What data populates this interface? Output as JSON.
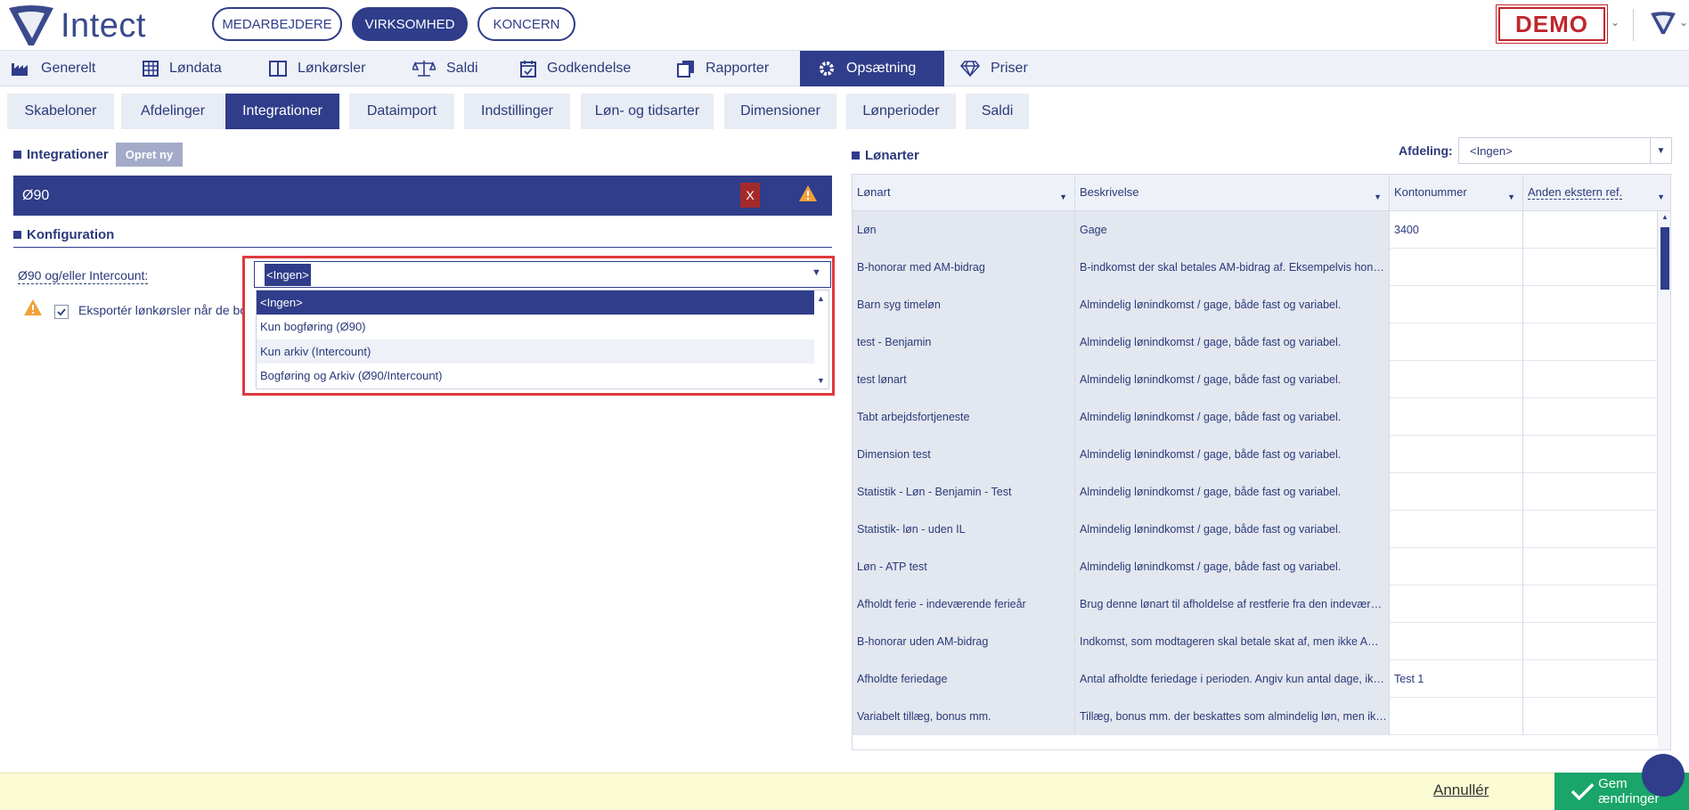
{
  "header": {
    "logo_text": "Intect",
    "pills": [
      "MEDARBEJDERE",
      "VIRKSOMHED",
      "KONCERN"
    ],
    "demo_label": "DEMO"
  },
  "main_nav": [
    {
      "label": "Generelt",
      "icon": "factory-icon"
    },
    {
      "label": "Løndata",
      "icon": "grid-icon"
    },
    {
      "label": "Lønkørsler",
      "icon": "book-icon"
    },
    {
      "label": "Saldi",
      "icon": "scale-icon"
    },
    {
      "label": "Godkendelse",
      "icon": "calendar-check-icon"
    },
    {
      "label": "Rapporter",
      "icon": "copy-icon"
    },
    {
      "label": "Opsætning",
      "icon": "gear-icon",
      "active": true
    },
    {
      "label": "Priser",
      "icon": "diamond-icon"
    }
  ],
  "sub_tabs": [
    "Skabeloner",
    "Afdelinger",
    "Integrationer",
    "Dataimport",
    "Indstillinger",
    "Løn- og tidsarter",
    "Dimensioner",
    "Lønperioder",
    "Saldi"
  ],
  "integrations": {
    "title": "Integrationer",
    "new_button": "Opret ny",
    "selected": "Ø90",
    "delete_label": "X"
  },
  "config": {
    "title": "Konfiguration",
    "field_label": "Ø90 og/eller Intercount:",
    "field_value": "<Ingen>",
    "checkbox_label": "Eksportér lønkørsler når de bogfø",
    "options": [
      "<Ingen>",
      "Kun bogføring (Ø90)",
      "Kun arkiv (Intercount)",
      "Bogføring og Arkiv (Ø90/Intercount)"
    ]
  },
  "lonarter": {
    "title": "Lønarter",
    "afdeling_label": "Afdeling:",
    "afdeling_value": "<Ingen>",
    "columns": [
      "Lønart",
      "Beskrivelse",
      "Kontonummer",
      "Anden ekstern ref."
    ],
    "rows": [
      [
        "Løn",
        "Gage",
        "3400",
        ""
      ],
      [
        "B-honorar med AM-bidrag",
        "B-indkomst der skal betales AM-bidrag af. Eksempelvis hon…",
        "",
        ""
      ],
      [
        "Barn syg timeløn",
        "Almindelig lønindkomst / gage, både fast og variabel.",
        "",
        ""
      ],
      [
        "test - Benjamin",
        "Almindelig lønindkomst / gage, både fast og variabel.",
        "",
        ""
      ],
      [
        "test lønart",
        "Almindelig lønindkomst / gage, både fast og variabel.",
        "",
        ""
      ],
      [
        "Tabt arbejdsfortjeneste",
        "Almindelig lønindkomst / gage, både fast og variabel.",
        "",
        ""
      ],
      [
        "Dimension test",
        "Almindelig lønindkomst / gage, både fast og variabel.",
        "",
        ""
      ],
      [
        "Statistik - Løn - Benjamin - Test",
        "Almindelig lønindkomst / gage, både fast og variabel.",
        "",
        ""
      ],
      [
        "Statistik- løn - uden IL",
        "Almindelig lønindkomst / gage, både fast og variabel.",
        "",
        ""
      ],
      [
        "Løn - ATP test",
        "Almindelig lønindkomst / gage, både fast og variabel.",
        "",
        ""
      ],
      [
        "Afholdt ferie - indeværende ferieår",
        "Brug denne lønart til afholdelse af restferie fra den indevær…",
        "",
        ""
      ],
      [
        "B-honorar uden AM-bidrag",
        "Indkomst, som modtageren skal betale skat af, men ikke A…",
        "",
        ""
      ],
      [
        "Afholdte feriedage",
        "Antal afholdte feriedage i perioden. Angiv kun antal dage, ik…",
        "Test 1",
        ""
      ],
      [
        "Variabelt tillæg, bonus mm.",
        "Tillæg, bonus mm. der beskattes som almindelig løn, men ik…",
        "",
        ""
      ]
    ]
  },
  "footer": {
    "cancel_label": "Annullér",
    "save_label": "Gem ændringer"
  }
}
